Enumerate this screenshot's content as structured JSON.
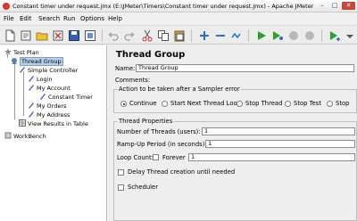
{
  "window": {
    "title": "Constant timer under request.jmx (E:\\JMeter\\Timers\\Constant timer under request.jmx) - Apache JMeter (2...",
    "controls": {
      "minimize": "–",
      "maximize": "□",
      "close": "✕"
    }
  },
  "menu": {
    "items": [
      "File",
      "Edit",
      "Search",
      "Run",
      "Options",
      "Help"
    ]
  },
  "toolbar": {
    "icons": [
      "new-file-icon",
      "templates-icon",
      "open-folder-icon",
      "close-icon",
      "save-icon",
      "save-as-icon",
      "undo-icon",
      "redo-icon",
      "cut-icon",
      "copy-icon",
      "paste-icon",
      "expand-icon",
      "collapse-icon",
      "toggle-icon",
      "start-icon",
      "start-no-pauses-icon",
      "stop-icon",
      "shutdown-icon",
      "remote-start-icon"
    ]
  },
  "tree": {
    "nodes": [
      {
        "label": "Test Plan",
        "icon": "test-plan-icon"
      },
      {
        "label": "Thread Group",
        "icon": "thread-group-icon",
        "selected": true
      },
      {
        "label": "Simple Controller",
        "icon": "controller-icon"
      },
      {
        "label": "Login",
        "icon": "sampler-icon"
      },
      {
        "label": "My Account",
        "icon": "sampler-icon"
      },
      {
        "label": "Constant Timer",
        "icon": "timer-icon"
      },
      {
        "label": "My Orders",
        "icon": "sampler-icon"
      },
      {
        "label": "My Address",
        "icon": "sampler-icon"
      },
      {
        "label": "View Results in Table",
        "icon": "listener-icon"
      },
      {
        "label": "WorkBench",
        "icon": "workbench-icon"
      }
    ]
  },
  "panel": {
    "heading": "Thread Group",
    "name_label": "Name:",
    "name_value": "Thread Group",
    "comments_label": "Comments:",
    "sampler_error": {
      "legend": "Action to be taken after a Sampler error",
      "options": [
        "Continue",
        "Start Next Thread Loop",
        "Stop Thread",
        "Stop Test",
        "Stop"
      ],
      "selected": "Continue"
    },
    "thread_properties": {
      "legend": "Thread Properties",
      "threads_label": "Number of Threads (users):",
      "threads_value": "1",
      "rampup_label": "Ramp-Up Period (in seconds):",
      "rampup_value": "1",
      "loop_label": "Loop Count:",
      "forever_label": "Forever",
      "loop_value": "1",
      "delay_label": "Delay Thread creation until needed",
      "scheduler_label": "Scheduler"
    }
  },
  "colors": {
    "selection": "#b8cfe5",
    "close_button": "#c9463d"
  }
}
